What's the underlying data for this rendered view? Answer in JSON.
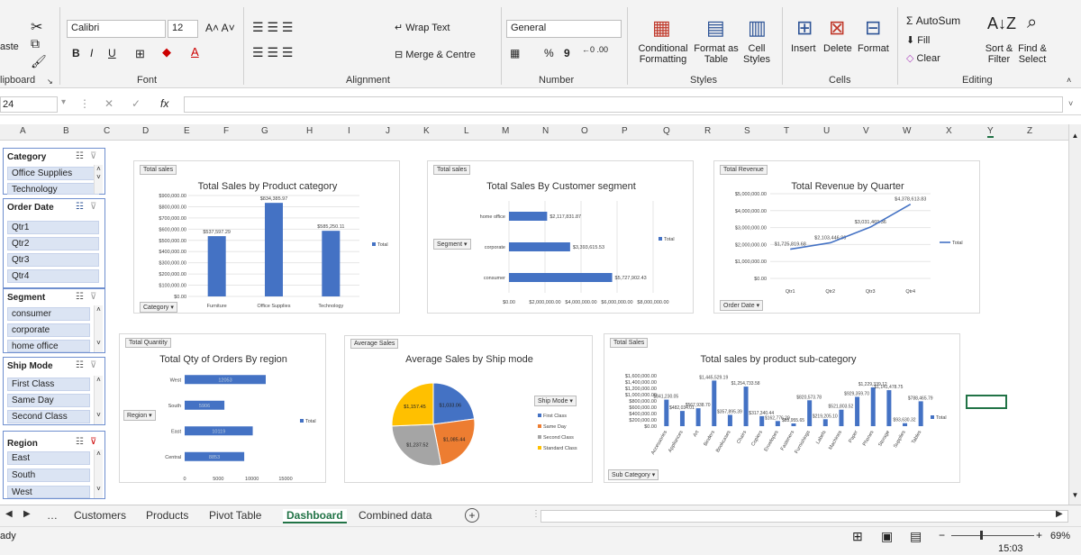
{
  "ribbon": {
    "clipboard": {
      "paste": "aste",
      "label": "lipboard"
    },
    "font": {
      "name": "Calibri",
      "size": "12",
      "label": "Font",
      "bold": "B",
      "italic": "I",
      "underline": "U"
    },
    "alignment": {
      "wrap": "Wrap Text",
      "merge": "Merge & Centre",
      "label": "Alignment"
    },
    "number": {
      "format": "General",
      "percent": "%",
      "comma": "9",
      "label": "Number"
    },
    "styles": {
      "conditional": "Conditional",
      "conditional2": "Formatting",
      "format_as": "Format as",
      "format_as2": "Table",
      "cell": "Cell",
      "cell2": "Styles",
      "label": "Styles"
    },
    "cells": {
      "insert": "Insert",
      "delete": "Delete",
      "format": "Format",
      "label": "Cells"
    },
    "editing": {
      "autosum": "AutoSum",
      "fill": "Fill",
      "clear": "Clear",
      "sort": "Sort &",
      "sort2": "Filter",
      "find": "Find &",
      "find2": "Select",
      "label": "Editing"
    }
  },
  "formula_bar": {
    "name_box": "24",
    "fx": "fx",
    "content": ""
  },
  "columns": [
    "A",
    "B",
    "C",
    "D",
    "E",
    "F",
    "G",
    "H",
    "I",
    "J",
    "K",
    "L",
    "M",
    "N",
    "O",
    "P",
    "Q",
    "R",
    "S",
    "T",
    "U",
    "V",
    "W",
    "X",
    "Y",
    "Z"
  ],
  "slicers": {
    "category": {
      "title": "Category",
      "items": [
        "Office Supplies",
        "Technology"
      ]
    },
    "order_date": {
      "title": "Order Date",
      "items": [
        "Qtr1",
        "Qtr2",
        "Qtr3",
        "Qtr4"
      ]
    },
    "segment": {
      "title": "Segment",
      "items": [
        "consumer",
        "corporate",
        "home office"
      ]
    },
    "ship_mode": {
      "title": "Ship Mode",
      "items": [
        "First Class",
        "Same Day",
        "Second Class"
      ]
    },
    "region": {
      "title": "Region",
      "items": [
        "East",
        "South",
        "West"
      ]
    }
  },
  "charts": {
    "product_category": {
      "tag": "Total sales",
      "title": "Total Sales by Product category",
      "field": "Category",
      "legend": "Total",
      "y_ticks": [
        "$900,000.00",
        "$800,000.00",
        "$700,000.00",
        "$600,000.00",
        "$500,000.00",
        "$400,000.00",
        "$300,000.00",
        "$200,000.00",
        "$100,000.00",
        "$0.00"
      ]
    },
    "customer_segment": {
      "tag": "Total sales",
      "title": "Total Sales By Customer segment",
      "field": "Segment",
      "legend": "Total",
      "x_ticks": [
        "$0.00",
        "$2,000,000.00",
        "$4,000,000.00",
        "$6,000,000.00",
        "$8,000,000.00"
      ]
    },
    "revenue_quarter": {
      "tag": "Total Revenue",
      "title": "Total Revenue by Quarter",
      "field": "Order Date",
      "legend": "Total",
      "y_ticks": [
        "$5,000,000.00",
        "$4,000,000.00",
        "$3,000,000.00",
        "$2,000,000.00",
        "$1,000,000.00",
        "$0.00"
      ]
    },
    "qty_region": {
      "tag": "Total Quantity",
      "title": "Total Qty of Orders By region",
      "field": "Region",
      "legend": "Total",
      "x_ticks": [
        "0",
        "5000",
        "10000",
        "15000"
      ]
    },
    "ship_mode": {
      "tag": "Average Sales",
      "title": "Average Sales by Ship mode",
      "legend_title": "Ship Mode"
    },
    "sub_category": {
      "tag": "Total Sales",
      "title": "Total sales by product sub-category",
      "field": "Sub Category",
      "legend": "Total",
      "y_ticks": [
        "$1,600,000.00",
        "$1,400,000.00",
        "$1,200,000.00",
        "$1,000,000.00",
        "$800,000.00",
        "$600,000.00",
        "$400,000.00",
        "$200,000.00",
        "$0.00"
      ]
    }
  },
  "chart_data": [
    {
      "type": "bar",
      "title": "Total Sales by Product category",
      "categories": [
        "Furniture",
        "Office Supplies",
        "Technology"
      ],
      "values": [
        537597.29,
        834385.97,
        585250.11
      ],
      "labels": [
        "$537,597.29",
        "$834,385.97",
        "$585,250.11"
      ],
      "ylim": [
        0,
        900000
      ],
      "color": "#4472C4"
    },
    {
      "type": "bar",
      "orientation": "horizontal",
      "title": "Total Sales By Customer segment",
      "categories": [
        "home office",
        "corporate",
        "consumer"
      ],
      "values": [
        2117831.87,
        3393615.53,
        5727902.43
      ],
      "labels": [
        "$2,117,831.87",
        "$3,393,615.53",
        "$5,727,902.43"
      ],
      "xlim": [
        0,
        8000000
      ],
      "color": "#4472C4"
    },
    {
      "type": "line",
      "title": "Total Revenue by Quarter",
      "categories": [
        "Qtr1",
        "Qtr2",
        "Qtr3",
        "Qtr4"
      ],
      "values": [
        1725819.68,
        2103446.96,
        3031469.36,
        4378613.83
      ],
      "labels": [
        "$1,725,819.68",
        "$2,103,446.96",
        "$3,031,469.36",
        "$4,378,613.83"
      ],
      "ylim": [
        0,
        5000000
      ],
      "color": "#4472C4"
    },
    {
      "type": "bar",
      "orientation": "horizontal",
      "title": "Total Qty of Orders By region",
      "categories": [
        "West",
        "South",
        "East",
        "Central"
      ],
      "values": [
        12053,
        5906,
        10119,
        8853
      ],
      "labels": [
        "12053",
        "5906",
        "10119",
        "8853"
      ],
      "xlim": [
        0,
        15000
      ],
      "color": "#4472C4"
    },
    {
      "type": "pie",
      "title": "Average Sales by Ship mode",
      "categories": [
        "First Class",
        "Same Day",
        "Second Class",
        "Standard Class"
      ],
      "values": [
        1033.06,
        1085.44,
        1237.52,
        1157.45
      ],
      "labels": [
        "$1,033.06",
        "$1,085.44",
        "$1,237.52",
        "$1,157.45"
      ],
      "colors": [
        "#4472C4",
        "#ED7D31",
        "#A5A5A5",
        "#FFC000"
      ]
    },
    {
      "type": "bar",
      "title": "Total sales by product sub-category",
      "categories": [
        "Accessories",
        "Appliances",
        "Art",
        "Binders",
        "Bookcases",
        "Chairs",
        "Copiers",
        "Envelopes",
        "Fasteners",
        "Furnishings",
        "Labels",
        "Machines",
        "Paper",
        "Phones",
        "Storage",
        "Supplies",
        "Tables"
      ],
      "values": [
        841230.05,
        482034.01,
        567938.7,
        1445529.19,
        357895.39,
        1254733.58,
        317340.44,
        162776.29,
        85955.65,
        820573.78,
        219205.1,
        521803.52,
        929359.7,
        1229339.12,
        1141478.75,
        93630.32,
        788465.79
      ],
      "labels": [
        "$841,230.05",
        "$482,034.01",
        "$567,938.70",
        "$1,445,529.19",
        "$357,895.39",
        "$1,254,733.58",
        "$317,340.44",
        "$162,776.29",
        "$85,955.65",
        "$820,573.78",
        "$219,205.10",
        "$521,803.52",
        "$929,359.70",
        "$1,229,339.12",
        "$1,141,478.75",
        "$93,630.32",
        "$788,465.79"
      ],
      "ylim": [
        0,
        1600000
      ],
      "color": "#4472C4"
    }
  ],
  "sheet_tabs": [
    "Customers",
    "Products",
    "Pivot Table",
    "Dashboard",
    "Combined data"
  ],
  "active_tab": "Dashboard",
  "status": {
    "left": "ady",
    "zoom": "69%",
    "time": "15:03"
  }
}
